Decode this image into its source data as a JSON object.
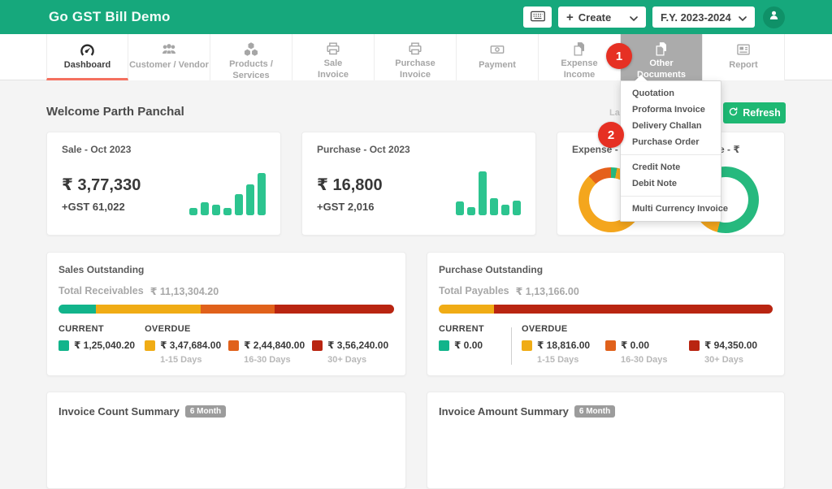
{
  "header": {
    "title": "Go GST Bill Demo",
    "create_label": "Create",
    "fy_value": "F.Y. 2023-2024"
  },
  "nav": {
    "tabs": [
      "Dashboard",
      "Customer / Vendor",
      "Products / Services",
      "Sale\nInvoice",
      "Purchase\nInvoice",
      "Payment",
      "Expense\nIncome",
      "Other\nDocuments",
      "Report"
    ],
    "active_tab": "Dashboard",
    "open_tab": "Other Documents"
  },
  "badges": {
    "step1": "1",
    "step2": "2"
  },
  "menu": {
    "groups": [
      {
        "items": [
          "Quotation",
          "Proforma Invoice",
          "Delivery Challan",
          "Purchase Order"
        ]
      },
      {
        "items": [
          "Credit Note",
          "Debit Note"
        ]
      },
      {
        "items": [
          "Multi Currency Invoice"
        ]
      }
    ]
  },
  "welcome": {
    "text": "Welcome Parth Panchal",
    "last_fragment": "Las",
    "refresh_label": "Refresh"
  },
  "cards": {
    "sale": {
      "title": "Sale - Oct 2023",
      "amount": "₹ 3,77,330",
      "gst": "+GST 61,022",
      "bars": [
        9,
        16,
        13,
        9,
        26,
        38,
        52
      ],
      "bar_color": "#2cc48f"
    },
    "purchase": {
      "title": "Purchase - Oct 2023",
      "amount": "₹ 16,800",
      "gst": "+GST 2,016",
      "bars": [
        17,
        10,
        54,
        21,
        13,
        18
      ],
      "bar_color": "#2cc48f"
    },
    "expense_income": {
      "title_left_fragment": "Expense - ₹ 5,",
      "title_right_fragment": "e - ₹",
      "donuts": [
        {
          "name": "expense-donut",
          "segments": [
            {
              "color": "#26b97e",
              "pct": 3
            },
            {
              "color": "#f4a61d",
              "pct": 85
            },
            {
              "color": "#e5601b",
              "pct": 12
            }
          ]
        },
        {
          "name": "income-donut",
          "segments": [
            {
              "color": "#26b97e",
              "pct": 54
            },
            {
              "color": "#f4a61d",
              "pct": 12.5
            },
            {
              "color": "#26b97e",
              "pct": 18
            },
            {
              "color": "#c0392b",
              "pct": 2.8
            },
            {
              "color": "#26b97e",
              "pct": 12.7
            }
          ]
        }
      ]
    }
  },
  "sales_outstanding": {
    "title": "Sales Outstanding",
    "total_label": "Total Receivables",
    "total_value": "₹ 11,13,304.20",
    "current_label": "CURRENT",
    "overdue_label": "OVERDUE",
    "bar_segments": [
      {
        "color": "#12b48b",
        "pct": 11.2
      },
      {
        "color": "#f0ac15",
        "pct": 31.2
      },
      {
        "color": "#e0611b",
        "pct": 22.0
      },
      {
        "color": "#b92511",
        "pct": 35.6
      }
    ],
    "current": {
      "color": "#12b48b",
      "amount": "₹ 1,25,040.20"
    },
    "overdue": [
      {
        "color": "#f0ac15",
        "amount": "₹ 3,47,684.00",
        "period": "1-15 Days"
      },
      {
        "color": "#e0611b",
        "amount": "₹ 2,44,840.00",
        "period": "16-30 Days"
      },
      {
        "color": "#b92511",
        "amount": "₹ 3,56,240.00",
        "period": "30+ Days"
      }
    ]
  },
  "purchase_outstanding": {
    "title": "Purchase Outstanding",
    "total_label": "Total Payables",
    "total_value": "₹ 1,13,166.00",
    "current_label": "CURRENT",
    "overdue_label": "OVERDUE",
    "bar_segments": [
      {
        "color": "#f0ac15",
        "pct": 16.6
      },
      {
        "color": "#b92511",
        "pct": 83.4
      }
    ],
    "current": {
      "color": "#12b48b",
      "amount": "₹ 0.00"
    },
    "overdue": [
      {
        "color": "#f0ac15",
        "amount": "₹ 18,816.00",
        "period": "1-15 Days"
      },
      {
        "color": "#e0611b",
        "amount": "₹ 0.00",
        "period": "16-30 Days"
      },
      {
        "color": "#b92511",
        "amount": "₹ 94,350.00",
        "period": "30+ Days"
      }
    ]
  },
  "summaries": {
    "count": {
      "title": "Invoice Count Summary",
      "badge": "6 Month"
    },
    "amount": {
      "title": "Invoice Amount Summary",
      "badge": "6 Month"
    }
  },
  "colors": {
    "header_green": "#16a87c",
    "refresh_green": "#1eb873",
    "avatar_green": "#0f9168",
    "active_tab_underline": "#f4705f",
    "open_tab_bg": "#ababab",
    "badge_red": "#e63023"
  }
}
